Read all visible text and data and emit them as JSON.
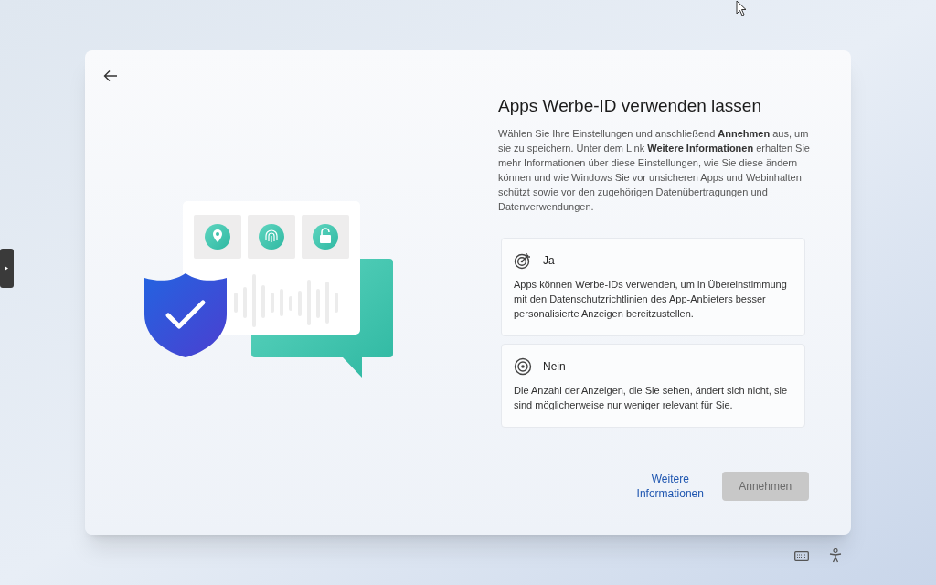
{
  "dialog": {
    "title": "Apps Werbe-ID verwenden lassen",
    "description": "Wählen Sie Ihre Einstellungen und anschließend **Annehmen** aus, um sie zu speichern. Unter dem Link **Weitere Informationen** erhalten Sie mehr Informationen über diese Einstellungen, wie Sie diese ändern können und wie Windows Sie vor unsicheren Apps und Webinhalten schützt sowie vor den zugehörigen Datenübertragungen und Datenverwendungen.",
    "options": [
      {
        "kind": "yes",
        "label": "Ja",
        "description": "Apps können Werbe-IDs verwenden, um in Übereinstimmung mit den Datenschutzrichtlinien des App-Anbieters besser personalisierte Anzeigen bereitzustellen.",
        "selected": false
      },
      {
        "kind": "no",
        "label": "Nein",
        "description": "Die Anzahl der Anzeigen, die Sie sehen, ändert sich nicht, sie sind möglicherweise nur weniger relevant für Sie.",
        "selected": false
      }
    ],
    "link": "Weitere Informationen",
    "accept_button": {
      "label": "Annehmen",
      "disabled": true
    }
  }
}
